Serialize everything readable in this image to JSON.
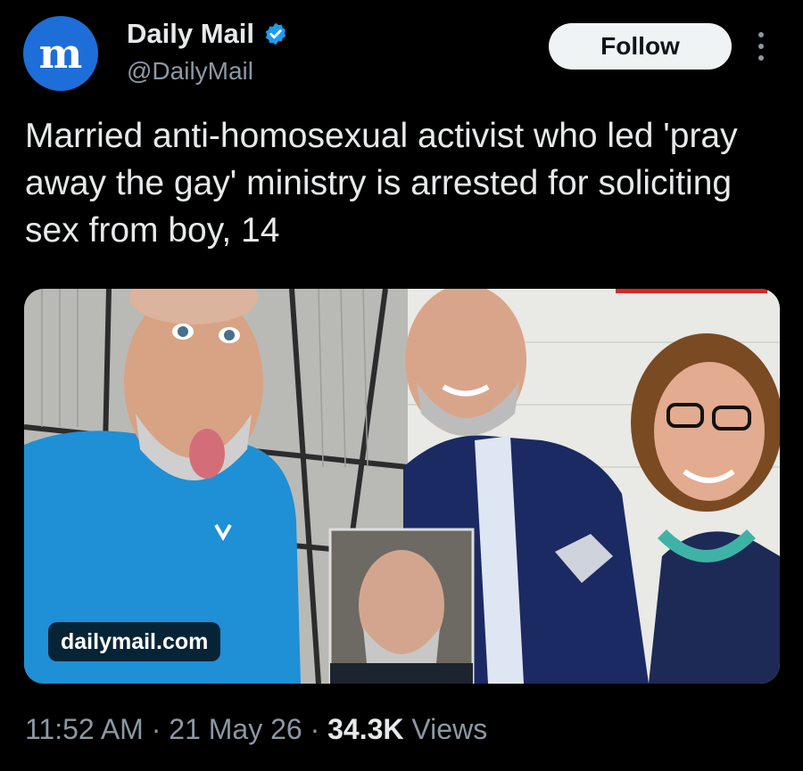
{
  "author": {
    "avatar_glyph": "m",
    "name": "Daily Mail",
    "handle": "@DailyMail",
    "verified_icon": "verified-badge-icon"
  },
  "actions": {
    "follow_label": "Follow",
    "more_icon": "vertical-ellipsis-icon"
  },
  "tweet": {
    "text": "Married anti-homosexual activist who led 'pray away the gay' ministry is arrested for soliciting sex from boy, 14"
  },
  "media": {
    "source_label": "dailymail.com"
  },
  "meta": {
    "time": "11:52 AM",
    "separator": " · ",
    "date": "21 May 26",
    "views_count": "34.3K",
    "views_label": " Views"
  },
  "colors": {
    "background": "#000000",
    "accent": "#1d9bf0",
    "brand": "#1d6ed8",
    "muted_text": "#8b98a5"
  }
}
